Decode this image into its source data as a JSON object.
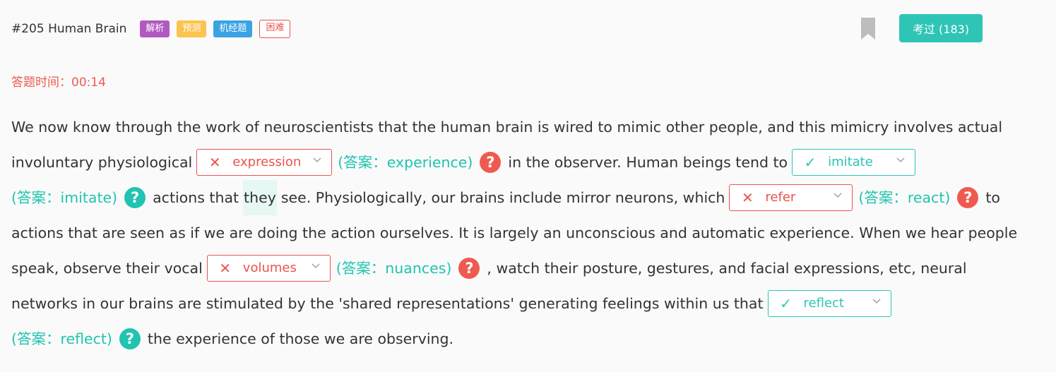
{
  "header": {
    "title": "#205 Human Brain",
    "tags": [
      "解析",
      "预测",
      "机经题",
      "困难"
    ],
    "passed_button": "考过 (183)"
  },
  "timer": {
    "label": "答题时间：00:14"
  },
  "colors": {
    "accent": "#2ec4b6",
    "error": "#e8554e",
    "tag_purple": "#b258c1",
    "tag_yellow": "#fcc44e",
    "tag_blue": "#3aa3e3"
  },
  "passage": {
    "l1": "We now know through the work of neuroscientists that the human brain is wired to mimic other people, and this mimicry involves actual",
    "l2a": "involuntary physiological",
    "b1": {
      "choice": "expression",
      "answer": "(答案：experience)",
      "correct": false
    },
    "l2b": "in the observer. Human beings tend to",
    "b2": {
      "choice": "imitate",
      "answer": "(答案：imitate)",
      "correct": true
    },
    "l3a": "actions that",
    "l3hl": "they",
    "l3b": "see. Physiologically, our brains include mirror neurons, which",
    "b3": {
      "choice": "refer",
      "answer": "(答案：react)",
      "correct": false
    },
    "l3c": "to",
    "l4": "actions that are seen as if we are doing the action ourselves. It is largely an unconscious and automatic experience. When we hear people",
    "l5a": "speak, observe their vocal",
    "b4": {
      "choice": "volumes",
      "answer": "(答案：nuances)",
      "correct": false
    },
    "l5b": ", watch their posture, gestures, and facial expressions, etc, neural",
    "l6a": "networks in our brains are stimulated by the 'shared representations' generating feelings within us that",
    "b5": {
      "choice": "reflect",
      "answer": "(答案：reflect)",
      "correct": true
    },
    "l7": "the experience of those we are observing."
  },
  "icons": {
    "wrong": "✕",
    "right": "✓",
    "help": "?"
  }
}
